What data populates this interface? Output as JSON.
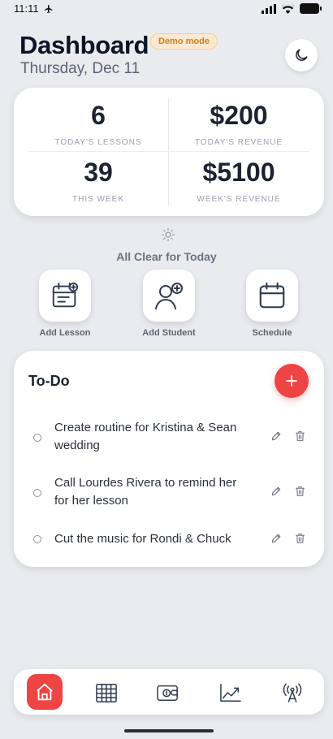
{
  "status_bar": {
    "time": "11:11"
  },
  "header": {
    "title": "Dashboard",
    "date": "Thursday, Dec 11",
    "badge": "Demo mode"
  },
  "stats": [
    {
      "value": "6",
      "label": "TODAY'S LESSONS"
    },
    {
      "value": "$200",
      "label": "TODAY'S REVENUE"
    },
    {
      "value": "39",
      "label": "THIS WEEK"
    },
    {
      "value": "$5100",
      "label": "WEEK'S REVENUE"
    }
  ],
  "status_message": "All Clear for Today",
  "quick_actions": [
    {
      "label": "Add Lesson",
      "icon": "add-lesson-icon"
    },
    {
      "label": "Add Student",
      "icon": "add-student-icon"
    },
    {
      "label": "Schedule",
      "icon": "calendar-icon"
    }
  ],
  "todo": {
    "title": "To-Do",
    "items": [
      {
        "text": "Create routine for Kristina & Sean wedding"
      },
      {
        "text": "Call Lourdes Rivera to remind her for her lesson"
      },
      {
        "text": "Cut the music for Rondi & Chuck"
      }
    ]
  },
  "nav": {
    "items": [
      "home-icon",
      "schedule-grid-icon",
      "wallet-icon",
      "chart-icon",
      "broadcast-icon"
    ],
    "active": "home-icon"
  },
  "colors": {
    "accent": "#ef4444",
    "badge_text": "#c98123",
    "background": "#e9ebef"
  }
}
